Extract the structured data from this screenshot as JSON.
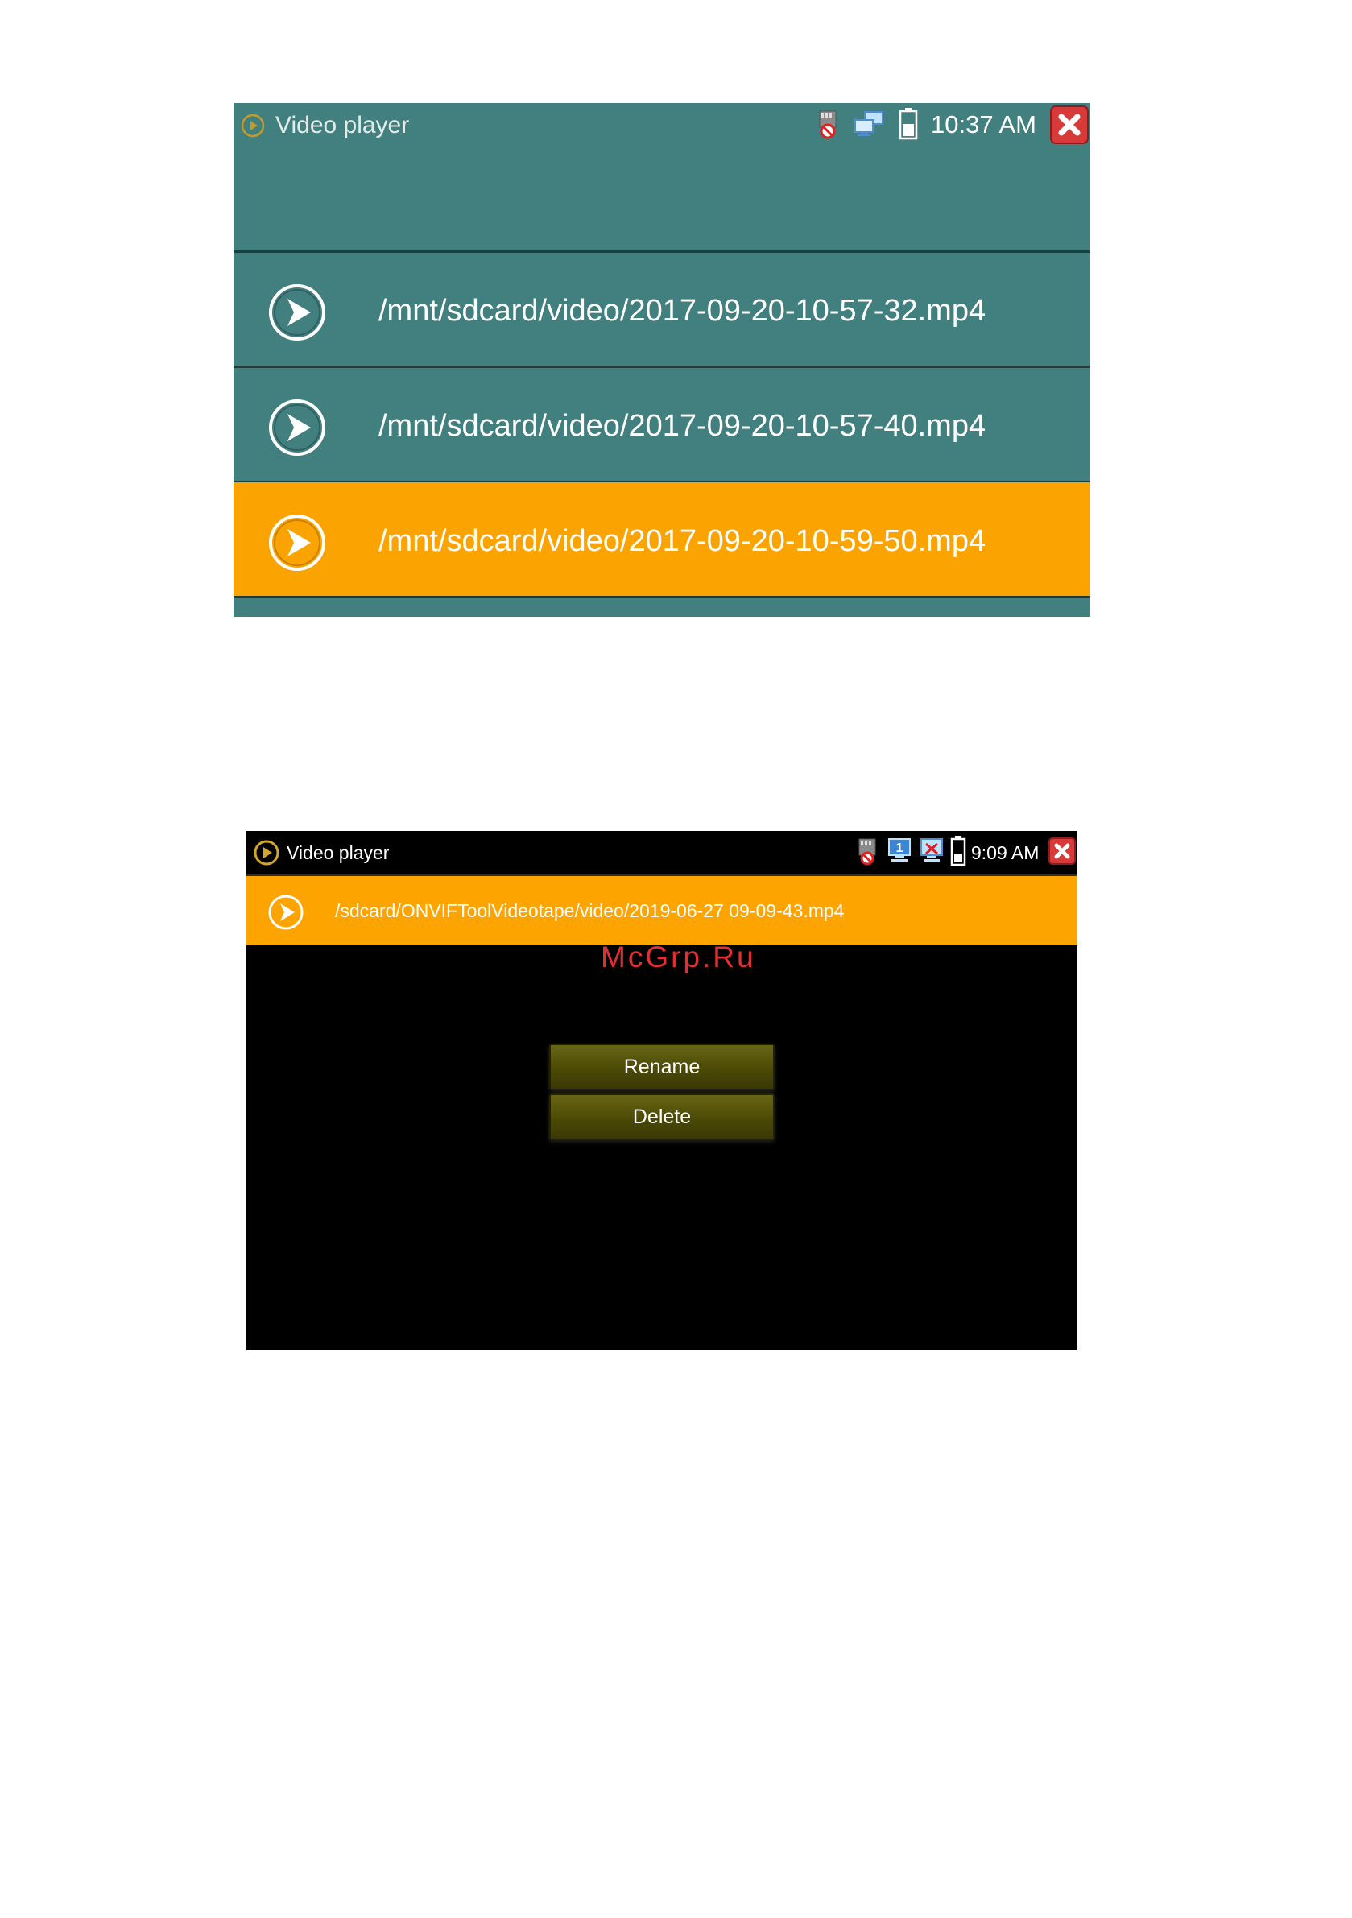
{
  "screen1": {
    "app_title": "Video player",
    "time": "10:37 AM",
    "files": [
      {
        "name": "/mnt/sdcard/video/2017-09-20-10-57-32.mp4",
        "selected": false
      },
      {
        "name": "/mnt/sdcard/video/2017-09-20-10-57-40.mp4",
        "selected": false
      },
      {
        "name": "/mnt/sdcard/video/2017-09-20-10-59-50.mp4",
        "selected": true
      }
    ],
    "colors": {
      "background": "#428080",
      "selected": "#fba300"
    },
    "icons": [
      "play-circle-icon",
      "sd-card-icon",
      "network-icon",
      "battery-icon",
      "close-icon"
    ]
  },
  "screen2": {
    "app_title": "Video player",
    "time": "9:09 AM",
    "file": "/sdcard/ONVIFToolVideotape/video/2019-06-27 09-09-43.mp4",
    "menu": {
      "rename_label": "Rename",
      "delete_label": "Delete"
    },
    "colors": {
      "background": "#000000",
      "selected": "#fea400",
      "button": "#55530a"
    },
    "icons": [
      "play-circle-icon",
      "sd-card-icon",
      "info-icon",
      "link-icon",
      "battery-icon",
      "close-icon"
    ]
  },
  "watermark": "McGrp.Ru"
}
